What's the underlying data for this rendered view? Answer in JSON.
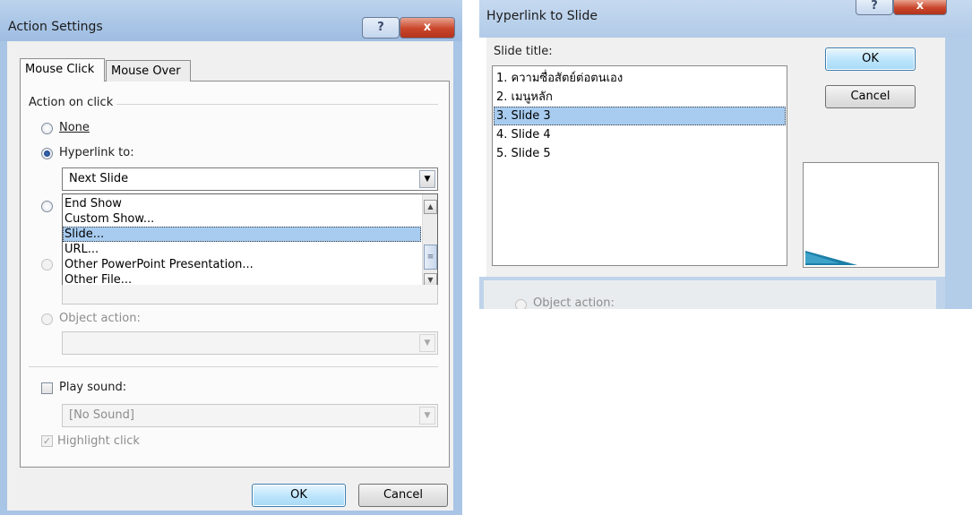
{
  "action_settings": {
    "title": "Action Settings",
    "help_glyph": "?",
    "close_glyph": "x",
    "tabs": [
      {
        "label": "Mouse Click",
        "active": true
      },
      {
        "label": "Mouse Over",
        "active": false
      }
    ],
    "group_label": "Action on click",
    "options": {
      "none": "None",
      "hyperlink": "Hyperlink to:",
      "object_action": "Object action:"
    },
    "hyperlink_value": "Next Slide",
    "dropdown_items": [
      {
        "label": "End Show",
        "selected": false
      },
      {
        "label": "Custom Show...",
        "selected": false
      },
      {
        "label": "Slide...",
        "selected": true
      },
      {
        "label": "URL...",
        "selected": false
      },
      {
        "label": "Other PowerPoint Presentation...",
        "selected": false
      },
      {
        "label": "Other File...",
        "selected": false
      }
    ],
    "play_sound_label": "Play sound:",
    "sound_value": "[No Sound]",
    "highlight_click_label": "Highlight click",
    "ok_label": "OK",
    "cancel_label": "Cancel"
  },
  "hyperlink_to_slide": {
    "title": "Hyperlink to Slide",
    "help_glyph": "?",
    "close_glyph": "x",
    "slide_title_label": "Slide title:",
    "slides": [
      {
        "label": "1. ความซื่อสัตย์ต่อตนเอง",
        "selected": false
      },
      {
        "label": "2. เมนูหลัก",
        "selected": false
      },
      {
        "label": "3. Slide 3",
        "selected": true
      },
      {
        "label": "4. Slide 4",
        "selected": false
      },
      {
        "label": "5. Slide 5",
        "selected": false
      }
    ],
    "ok_label": "OK",
    "cancel_label": "Cancel",
    "background_object_action": "Object action:"
  },
  "colors": {
    "title_bar": "#a9c5e6",
    "selection": "#a8ccf0",
    "close_button": "#c9452b"
  },
  "icons": {
    "help": "question-mark-icon",
    "close": "close-icon",
    "dropdown": "chevron-down-icon",
    "scroll_up": "scroll-up-icon",
    "scroll_down": "scroll-down-icon"
  }
}
